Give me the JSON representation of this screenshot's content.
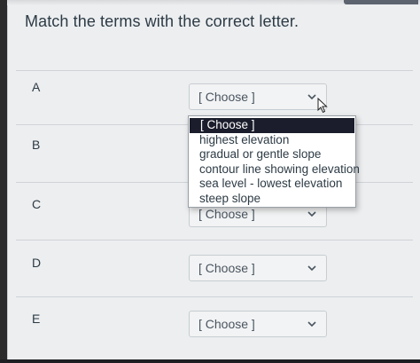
{
  "question": {
    "prompt": "Match the terms with the correct letter."
  },
  "rows": [
    {
      "label": "A",
      "value": "[ Choose ]"
    },
    {
      "label": "B",
      "value": ""
    },
    {
      "label": "C",
      "value": "[ Choose ]"
    },
    {
      "label": "D",
      "value": "[ Choose ]"
    },
    {
      "label": "E",
      "value": "[ Choose ]"
    }
  ],
  "dropdown": {
    "open_for": "A",
    "options": [
      "[ Choose ]",
      "highest elevation",
      "gradual or gentle slope",
      "contour line showing elevation",
      "sea level - lowest elevation",
      "steep slope"
    ],
    "highlighted_index": 0
  },
  "colors": {
    "text": "#2d3b45",
    "highlight": "#1b1d2c",
    "page_bg": "#eceef0"
  },
  "icons": {
    "select_arrow": "chevron-down-icon",
    "pointer": "mouse-cursor-icon"
  }
}
